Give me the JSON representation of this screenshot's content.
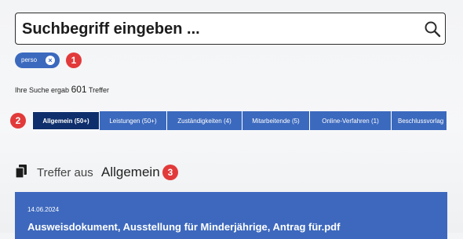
{
  "search": {
    "placeholder": "Suchbegriff eingeben ..."
  },
  "filter_chip": {
    "label": "perso"
  },
  "annotations": {
    "badge_1": "1",
    "badge_2": "2",
    "badge_3": "3"
  },
  "results": {
    "prefix": "Ihre Suche ergab",
    "count": "601",
    "suffix": "Treffer"
  },
  "tabs": [
    {
      "label": "Allgemein (50+)",
      "active": true
    },
    {
      "label": "Leistungen (50+)"
    },
    {
      "label": "Zuständigkeiten (4)"
    },
    {
      "label": "Mitarbeitende (5)"
    },
    {
      "label": "Online-Verfahren (1)"
    },
    {
      "label": "Beschlussvorlag"
    }
  ],
  "section": {
    "prefix": "Treffer aus",
    "category": "Allgemein"
  },
  "result_card": {
    "date": "14.06.2024",
    "title": "Ausweisdokument, Ausstellung für Minderjährige, Antrag für.pdf"
  },
  "colors": {
    "accent": "#3b69be",
    "active_tab": "#0f2f6c",
    "badge": "#e23a3a"
  }
}
